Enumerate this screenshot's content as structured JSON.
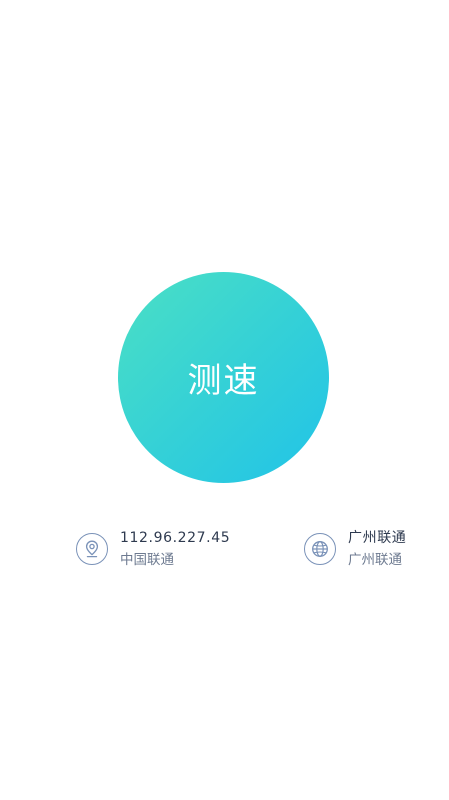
{
  "speed_test": {
    "label": "测速",
    "gradient_start": "#4be0c4",
    "gradient_end": "#21c3e8"
  },
  "client": {
    "icon": "location-pin-icon",
    "ip": "112.96.227.45",
    "isp": "中国联通"
  },
  "server": {
    "icon": "globe-icon",
    "name": "广州联通",
    "isp": "广州联通"
  },
  "colors": {
    "icon_stroke": "#7a92b8",
    "primary_text": "#2e3a4f",
    "secondary_text": "#6d7a90"
  }
}
